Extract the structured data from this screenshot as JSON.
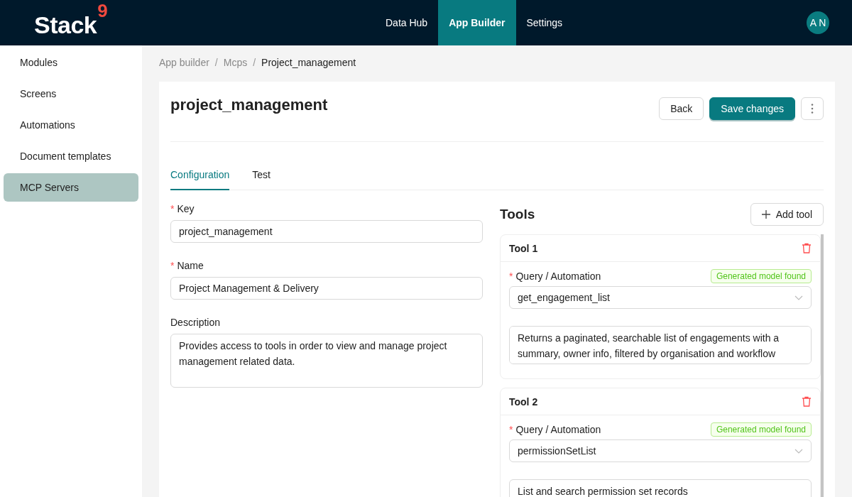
{
  "header": {
    "logo": "Stack",
    "logo_mark": "9",
    "nav": [
      {
        "label": "Data Hub",
        "selected": false
      },
      {
        "label": "App Builder",
        "selected": true
      },
      {
        "label": "Settings",
        "selected": false
      }
    ],
    "avatar": "A N"
  },
  "sidebar": {
    "items": [
      {
        "label": "Modules",
        "selected": false
      },
      {
        "label": "Screens",
        "selected": false
      },
      {
        "label": "Automations",
        "selected": false
      },
      {
        "label": "Document templates",
        "selected": false
      },
      {
        "label": "MCP Servers",
        "selected": true
      }
    ]
  },
  "breadcrumb": [
    "App builder",
    "Mcps",
    "Project_management"
  ],
  "breadcrumb_separator": "/",
  "page": {
    "title": "project_management",
    "buttons": {
      "back": "Back",
      "save": "Save changes"
    }
  },
  "tabs": [
    {
      "label": "Configuration",
      "selected": true
    },
    {
      "label": "Test",
      "selected": false
    }
  ],
  "form": [
    {
      "label": "Key",
      "required": true,
      "required_mark": "*",
      "kind": "input",
      "value": "project_management"
    },
    {
      "label": "Name",
      "required": true,
      "required_mark": "*",
      "kind": "input",
      "value": "Project Management & Delivery"
    },
    {
      "label": "Description",
      "required": false,
      "kind": "textarea",
      "value": "Provides access to tools in order to view and manage project management related data."
    }
  ],
  "tools": {
    "title": "Tools",
    "add_button": "Add tool",
    "items": [
      {
        "title": "Tool 1",
        "field_label": "Query / Automation",
        "required": true,
        "required_mark": "*",
        "badge": "Generated model found",
        "value": "get_engagement_list",
        "description": "Returns a paginated, searchable list of engagements with a summary, owner info, filtered by organisation and workflow"
      },
      {
        "title": "Tool 2",
        "field_label": "Query / Automation",
        "required": true,
        "required_mark": "*",
        "badge": "Generated model found",
        "value": "permissionSetList",
        "description": "List and search permission set records"
      }
    ]
  }
}
